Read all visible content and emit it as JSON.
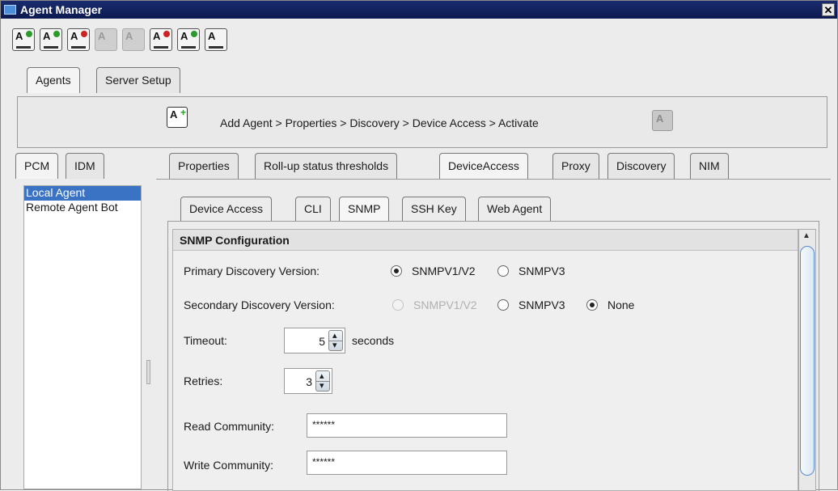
{
  "window": {
    "title": "Agent Manager",
    "close_label": "✕"
  },
  "toolbar": [
    {
      "icon": "add-agent-icon",
      "label": "A",
      "badge_color": "#2a9a2a",
      "disabled": false
    },
    {
      "icon": "discover-agents-icon",
      "label": "A",
      "badge_color": "#2a9a2a",
      "disabled": false
    },
    {
      "icon": "agent-properties-icon",
      "label": "A",
      "badge_color": "#cc2222",
      "disabled": false
    },
    {
      "icon": "copy-agent-icon",
      "label": "A",
      "badge_color": "",
      "disabled": true
    },
    {
      "icon": "agent-group-icon",
      "label": "A",
      "badge_color": "",
      "disabled": true
    },
    {
      "icon": "delete-agent-icon",
      "label": "A",
      "badge_color": "#cc2222",
      "disabled": false
    },
    {
      "icon": "refresh-agent-icon",
      "label": "A",
      "badge_color": "#2a9a2a",
      "disabled": false
    },
    {
      "icon": "agent-menu-icon",
      "label": "A",
      "badge_color": "",
      "disabled": false
    }
  ],
  "main_tabs": [
    "Agents",
    "Server Setup"
  ],
  "wizard": {
    "path": "Add Agent > Properties > Discovery > Device Access > Activate",
    "icon_label": "A",
    "plus": "+",
    "end_icon_label": "A"
  },
  "left_tabs": [
    "PCM",
    "IDM"
  ],
  "agents": [
    "Local Agent",
    "Remote Agent Bot"
  ],
  "right_tabs": [
    "Properties",
    "Roll-up status thresholds",
    "DeviceAccess",
    "Proxy",
    "Discovery",
    "NIM"
  ],
  "sub_tabs": [
    "Device Access",
    "CLI",
    "SNMP",
    "SSH Key",
    "Web Agent"
  ],
  "snmp": {
    "header": "SNMP Configuration",
    "primary_label": "Primary Discovery Version:",
    "primary_v1v2": "SNMPV1/V2",
    "primary_v3": "SNMPV3",
    "secondary_label": "Secondary Discovery Version:",
    "secondary_v1v2": "SNMPV1/V2",
    "secondary_v3": "SNMPV3",
    "secondary_none": "None",
    "timeout_label": "Timeout:",
    "timeout_value": "5",
    "timeout_unit": "seconds",
    "retries_label": "Retries:",
    "retries_value": "3",
    "read_label": "Read Community:",
    "read_value": "******",
    "write_label": "Write Community:",
    "write_value": "******"
  }
}
